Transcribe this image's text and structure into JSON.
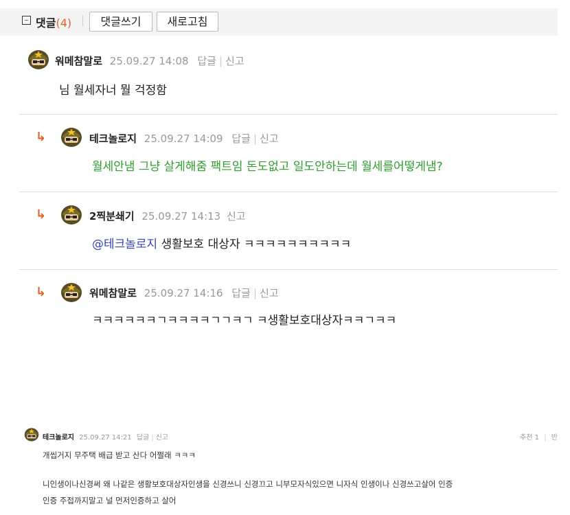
{
  "toolbar": {
    "collapse_icon": "minus-square-icon",
    "title": "댓글",
    "count": "(4)",
    "write_label": "댓글쓰기",
    "refresh_label": "새로고침"
  },
  "comments": [
    {
      "nick": "워메참말로",
      "time": "25.09.27 14:08",
      "reply": "답글",
      "report": "신고",
      "text": "님 월세자너 뭘 걱정함",
      "avatar_icon": "soldier-helmet-avatar-icon"
    },
    {
      "nick": "테크놀로지",
      "time": "25.09.27 14:09",
      "reply": "답글",
      "report": "신고",
      "text": "월세안냄 그냥 살게해줌 팩트임 돈도없고 일도안하는데 월세를어떻게냄?",
      "text_color": "#2e9f2e",
      "avatar_icon": "soldier-helmet-avatar-icon",
      "reply_icon": "reply-arrow-icon"
    },
    {
      "nick": "2찍분쇄기",
      "time": "25.09.27 14:13",
      "report": "신고",
      "mention": "@테크놀로지",
      "text": "생활보호 대상자 ㅋㅋㅋㅋㅋㅋㅋㅋㅋㅋ",
      "avatar_icon": "soldier-helmet-avatar-icon",
      "reply_icon": "reply-arrow-icon"
    },
    {
      "nick": "워메참말로",
      "time": "25.09.27 14:16",
      "reply": "답글",
      "report": "신고",
      "text": "ㅋㅋㅋㅋㅋㅋㄱㅋㅋㅋㅋㄱㄱㅋㄱ ㅋ생활보호대상자ㅋㅋㄱㅋㅋ",
      "avatar_icon": "soldier-helmet-avatar-icon",
      "reply_icon": "reply-arrow-icon"
    }
  ],
  "second": {
    "nick": "테크놀로지",
    "time": "25.09.27 14:21",
    "reply": "답글",
    "report": "신고",
    "recommend": "추천 1",
    "cut_label": "반",
    "line1": "개씹거지 무주택 배급 받고 산다 어쩔래 ㅋㅋㅋ",
    "line2": "니인생이나신경써 왜 나같은 생활보호대상자인생을 신경쓰니 신경끄고 니부모자식있으면 니자식 인생이나 신경쓰고살어 인증",
    "line3": "인증 주접까지말고 널 먼저인증하고 살어"
  }
}
